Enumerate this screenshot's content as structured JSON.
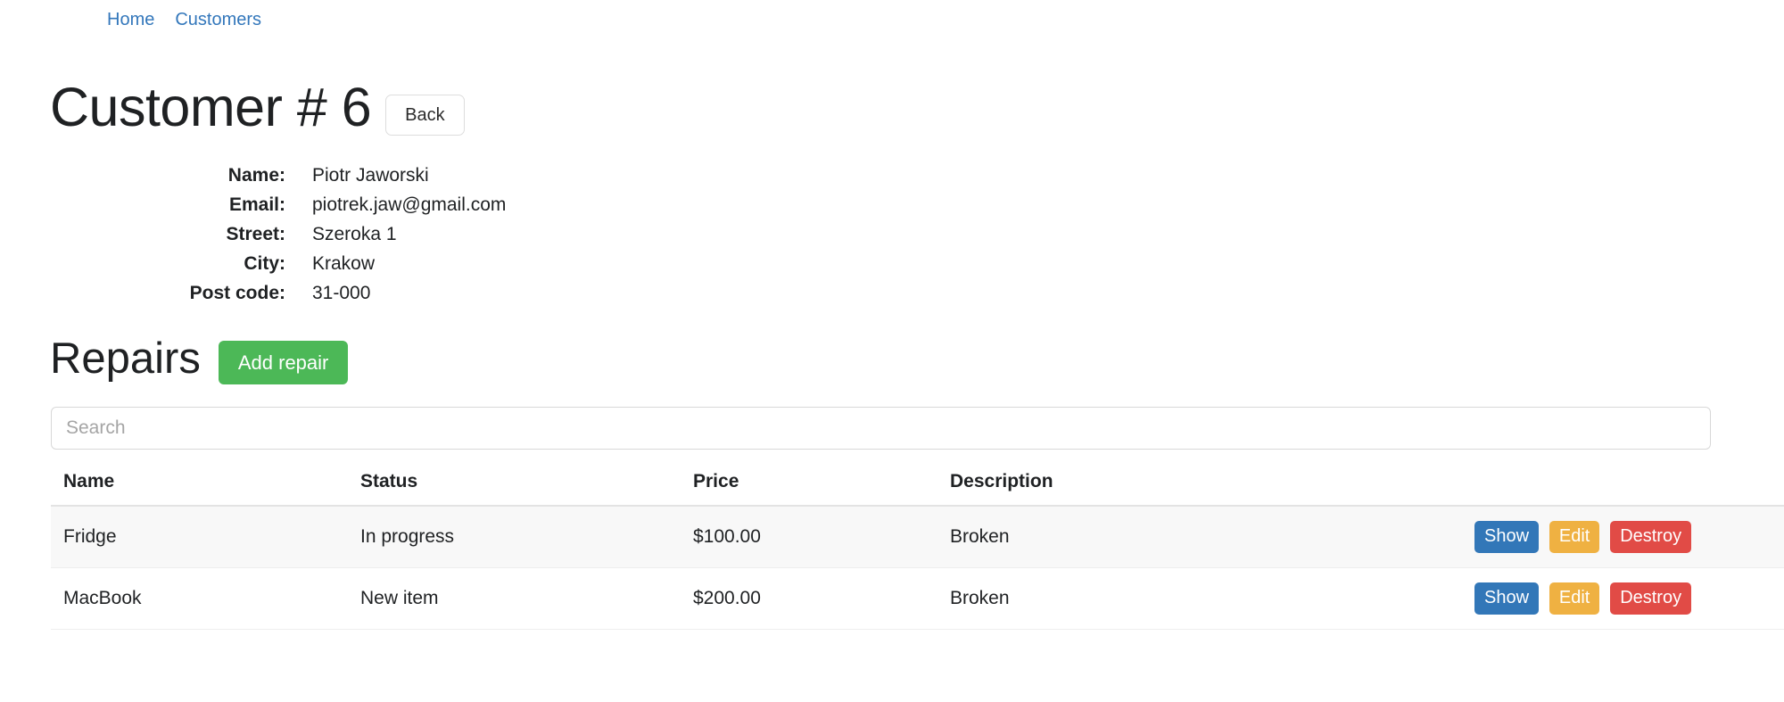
{
  "nav": {
    "links": [
      {
        "label": "Home"
      },
      {
        "label": "Customers"
      }
    ]
  },
  "header": {
    "title": "Customer # 6",
    "back_label": "Back"
  },
  "customer": {
    "fields": [
      {
        "label": "Name:",
        "value": "Piotr Jaworski"
      },
      {
        "label": "Email:",
        "value": "piotrek.jaw@gmail.com"
      },
      {
        "label": "Street:",
        "value": "Szeroka 1"
      },
      {
        "label": "City:",
        "value": "Krakow"
      },
      {
        "label": "Post code:",
        "value": "31-000"
      }
    ]
  },
  "repairs": {
    "title": "Repairs",
    "add_label": "Add repair",
    "search": {
      "placeholder": "Search",
      "value": ""
    },
    "columns": [
      "Name",
      "Status",
      "Price",
      "Description",
      ""
    ],
    "rows": [
      {
        "name": "Fridge",
        "status": "In progress",
        "price": "$100.00",
        "description": "Broken",
        "actions": {
          "show": "Show",
          "edit": "Edit",
          "destroy": "Destroy"
        }
      },
      {
        "name": "MacBook",
        "status": "New item",
        "price": "$200.00",
        "description": "Broken",
        "actions": {
          "show": "Show",
          "edit": "Edit",
          "destroy": "Destroy"
        }
      }
    ]
  },
  "colors": {
    "link": "#3377bb",
    "add_button": "#4cb857",
    "show_button": "#3277b8",
    "edit_button": "#efb142",
    "destroy_button": "#e14b46"
  }
}
